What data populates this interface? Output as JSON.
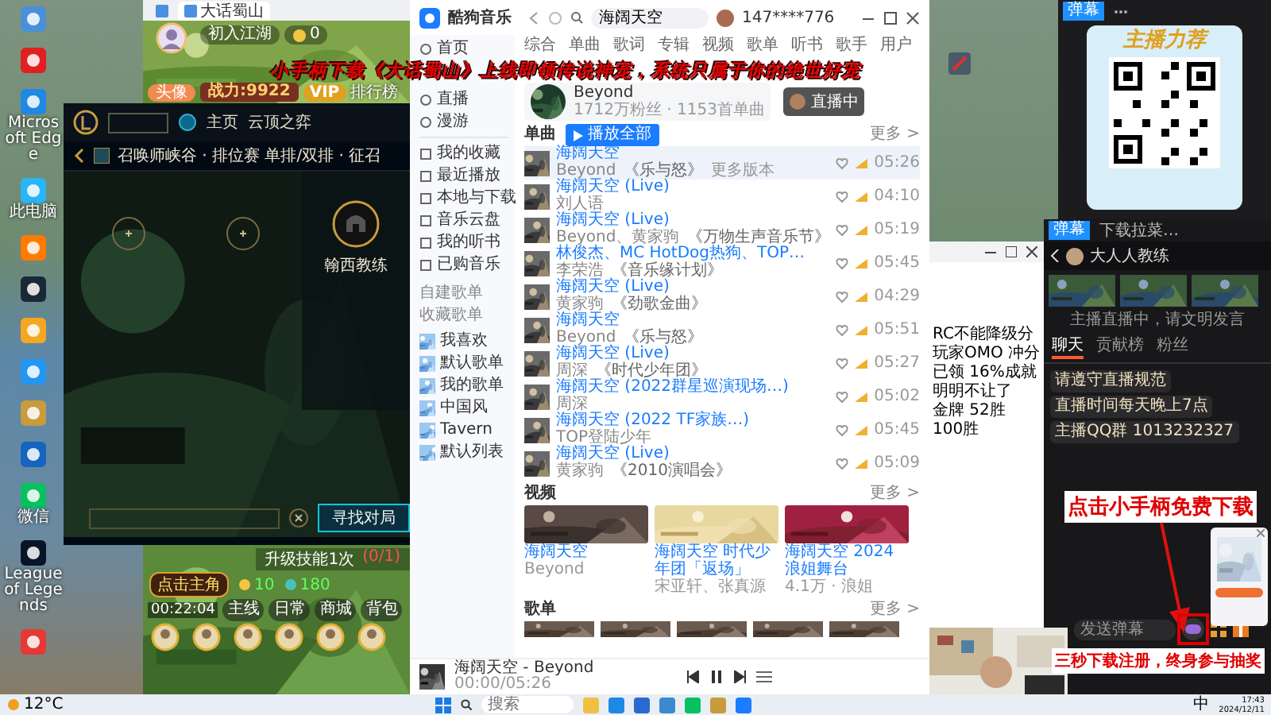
{
  "desktop_icons": [
    {
      "color": "#4a90d9"
    },
    {
      "color": "#e02020"
    },
    {
      "label": "Microsoft Edge",
      "color": "#1e88e5"
    },
    {
      "label": "此电脑",
      "color": "#29b6f6"
    },
    {
      "color": "#ff7a00"
    },
    {
      "color": "#1b2838"
    },
    {
      "color": "#f5a623"
    },
    {
      "color": "#2196f3"
    },
    {
      "color": "#c89b3c"
    },
    {
      "color": "#1565c0"
    },
    {
      "label": "微信",
      "color": "#07c160"
    },
    {
      "label": "League of Legends",
      "color": "#0a1428"
    },
    {
      "color": "#e53935"
    }
  ],
  "desktop_icons_right": [
    {
      "color": "#4a5a6a"
    }
  ],
  "game_window": {
    "tabs": [
      {
        "selected": false
      },
      {
        "label": "大话蜀山",
        "selected": true
      }
    ],
    "rank": "初入江湖",
    "power": "战力:9922",
    "coins": "0",
    "vip": "VIP",
    "leaderboard": "排行榜",
    "avatar_button": "头像"
  },
  "banner": "小手柄下载《大话蜀山》上线即领传说神宠，系统只属于你的绝世好宠",
  "lol": {
    "nav": [
      {
        "label": "主页",
        "selected": false
      },
      {
        "label": "云顶之弈",
        "selected": false
      }
    ],
    "mode": "召唤师峡谷 · 排位赛 单排/双排 · 征召",
    "player": "翰西教练",
    "find_match": "寻找对局"
  },
  "mobile_game": {
    "task": "升级技能1次",
    "task_progress": "(0/1)",
    "hint": "点击主角",
    "gold": "10",
    "gems": "180",
    "timer": "00:22:04",
    "menu": [
      {
        "label": "主线"
      },
      {
        "label": "日常"
      },
      {
        "label": "商城"
      },
      {
        "label": "背包"
      }
    ]
  },
  "music": {
    "app_name": "酷狗音乐",
    "search": {
      "value": "海阔天空"
    },
    "user": "147****776",
    "nav": [
      {
        "label": "首页"
      },
      {
        "label": "直播"
      },
      {
        "label": "漫游"
      }
    ],
    "library": [
      {
        "label": "我的收藏"
      },
      {
        "label": "最近播放"
      },
      {
        "label": "本地与下载"
      },
      {
        "label": "音乐云盘"
      },
      {
        "label": "我的听书"
      },
      {
        "label": "已购音乐"
      }
    ],
    "playlist_tabs": [
      "自建歌单",
      "收藏歌单"
    ],
    "playlists": [
      {
        "label": "我喜欢"
      },
      {
        "label": "默认歌单"
      },
      {
        "label": "我的歌单"
      },
      {
        "label": "中国风"
      },
      {
        "label": "Tavern"
      },
      {
        "label": "默认列表"
      }
    ],
    "search_tabs": [
      "综合",
      "单曲",
      "歌词",
      "专辑",
      "视频",
      "歌单",
      "听书",
      "歌手",
      "用户"
    ],
    "artist": {
      "name": "Beyond",
      "stats": "1712万粉丝 · 1153首单曲"
    },
    "live_pill": "直播中",
    "songs_heading": "单曲",
    "play_all": "播放全部",
    "songs_more": "更多 >",
    "songs": [
      {
        "title": "海阔天空",
        "artist": "Beyond",
        "album": "《乐与怒》",
        "duration": "05:26",
        "selected": true
      },
      {
        "title": "海阔天空 (Live)",
        "artist": "刘人语",
        "duration": "04:10",
        "selected": false
      },
      {
        "title": "海阔天空 (Live)",
        "artist": "Beyond、黄家驹",
        "album": "《万物生声音乐节》",
        "duration": "05:19",
        "selected": false
      },
      {
        "title": "林俊杰、MC HotDog热狗、TOP…",
        "artist": "李荣浩",
        "album": "《音乐缘计划》",
        "duration": "05:45",
        "selected": false
      },
      {
        "title": "海阔天空 (Live)",
        "artist": "黄家驹",
        "album": "《劲歌金曲》",
        "duration": "04:29",
        "selected": false
      },
      {
        "title": "海阔天空",
        "artist": "Beyond",
        "album": "《乐与怒》",
        "duration": "05:51",
        "selected": false
      },
      {
        "title": "海阔天空 (Live)",
        "artist": "周深",
        "album": "《时代少年团》",
        "duration": "05:27",
        "selected": false
      },
      {
        "title": "海阔天空 (2022群星巡演现场…)",
        "artist": "周深",
        "duration": "05:02",
        "selected": false
      },
      {
        "title": "海阔天空 (2022 TF家族…)",
        "artist": "TOP登陆少年",
        "duration": "05:45",
        "selected": false
      },
      {
        "title": "海阔天空 (Live)",
        "artist": "黄家驹",
        "album": "《2010演唱会》",
        "duration": "05:09",
        "selected": false
      }
    ],
    "more_versions": "更多版本",
    "videos_heading": "视频",
    "videos_more": "更多 >",
    "videos": [
      {
        "title": "海阔天空",
        "sub": "Beyond"
      },
      {
        "title": "海阔天空 时代少年团「返场」",
        "sub": "宋亚轩、张真源"
      },
      {
        "title": "海阔天空 2024浪姐舞台",
        "sub": "4.1万 · 浪姐"
      }
    ],
    "playlists_heading": "歌单",
    "playlists_more": "更多 >",
    "player": {
      "now_playing": "海阔天空 - Beyond",
      "time": "00:00/05:26",
      "playing": true
    }
  },
  "notepad": {
    "lines": [
      "RC不能降级分",
      "玩家OMO 冲分",
      "已领 16%成就",
      "明明不让了",
      "金牌 52胜",
      "100胜"
    ]
  },
  "qr_window": {
    "tag": "弹幕",
    "title": "主播力荐"
  },
  "live": {
    "tag": "弹幕",
    "title": "下载拉菜…",
    "streamer": "大人人教练",
    "notice": "主播直播中，请文明发言",
    "tabs": [
      {
        "label": "聊天",
        "selected": true
      },
      {
        "label": "贡献榜",
        "selected": false
      },
      {
        "label": "粉丝",
        "selected": false
      }
    ],
    "messages": [
      "请遵守直播规范",
      "直播时间每天晚上7点",
      "主播QQ群 1013232327"
    ],
    "input": {
      "placeholder": "发送弹幕"
    }
  },
  "promo_top": "点击小手柄免费下载",
  "promo_bottom": "三秒下载注册，终身参与抽奖",
  "taskbar": {
    "weather": "12°C",
    "search": {
      "placeholder": "搜索"
    },
    "ime": "中",
    "time": "17:43",
    "date": "2024/12/11"
  }
}
